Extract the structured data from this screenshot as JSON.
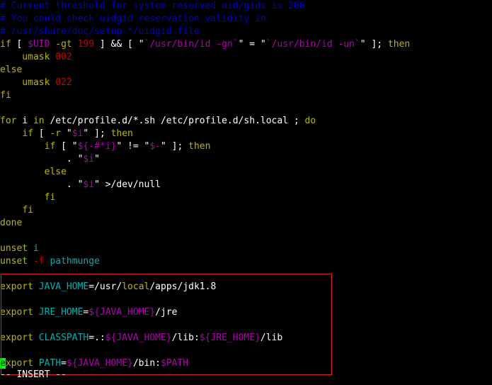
{
  "editor": {
    "mode_text": "-- INSERT --",
    "cursor_char": "e"
  },
  "colors": {
    "comment": "#0000cc",
    "keyword": "#b8b800",
    "variable": "#b000b0",
    "number": "#cc0000",
    "identifier": "#00b0b0",
    "default": "#ffffff",
    "highlight_border": "#e02020",
    "cursor": "#00ff00"
  },
  "lines": [
    [
      {
        "t": "# Current threshold for system reserved uid/gids is 200",
        "c": "comment"
      }
    ],
    [
      {
        "t": "# You could check uidgid reservation validity in",
        "c": "comment"
      }
    ],
    [
      {
        "t": "# /usr/share/doc/setup-*/uidgid file",
        "c": "comment"
      }
    ],
    [
      {
        "t": "if",
        "c": "keyword"
      },
      {
        "t": " [ ",
        "c": "default"
      },
      {
        "t": "$UID",
        "c": "variable"
      },
      {
        "t": " ",
        "c": "default"
      },
      {
        "t": "-gt",
        "c": "keyword"
      },
      {
        "t": " ",
        "c": "default"
      },
      {
        "t": "199",
        "c": "number"
      },
      {
        "t": " ] && [ \"",
        "c": "default"
      },
      {
        "t": "`/usr/bin/id -gn`",
        "c": "variable"
      },
      {
        "t": "\" = \"",
        "c": "default"
      },
      {
        "t": "`/usr/bin/id -un`",
        "c": "variable"
      },
      {
        "t": "\" ]; ",
        "c": "default"
      },
      {
        "t": "then",
        "c": "keyword"
      }
    ],
    [
      {
        "t": "    umask ",
        "c": "keyword"
      },
      {
        "t": "002",
        "c": "number"
      }
    ],
    [
      {
        "t": "else",
        "c": "keyword"
      }
    ],
    [
      {
        "t": "    umask ",
        "c": "keyword"
      },
      {
        "t": "022",
        "c": "number"
      }
    ],
    [
      {
        "t": "fi",
        "c": "keyword"
      }
    ],
    [],
    [
      {
        "t": "for",
        "c": "keyword"
      },
      {
        "t": " i ",
        "c": "default"
      },
      {
        "t": "in",
        "c": "keyword"
      },
      {
        "t": " /etc/profile.d/*.sh /etc/profile.d/sh.local ; ",
        "c": "default"
      },
      {
        "t": "do",
        "c": "keyword"
      }
    ],
    [
      {
        "t": "    ",
        "c": "default"
      },
      {
        "t": "if",
        "c": "keyword"
      },
      {
        "t": " [ ",
        "c": "default"
      },
      {
        "t": "-r",
        "c": "keyword"
      },
      {
        "t": " \"",
        "c": "default"
      },
      {
        "t": "$i",
        "c": "variable"
      },
      {
        "t": "\" ]; ",
        "c": "default"
      },
      {
        "t": "then",
        "c": "keyword"
      }
    ],
    [
      {
        "t": "        ",
        "c": "default"
      },
      {
        "t": "if",
        "c": "keyword"
      },
      {
        "t": " [ \"",
        "c": "default"
      },
      {
        "t": "${-#*i}",
        "c": "variable"
      },
      {
        "t": "\" != \"",
        "c": "default"
      },
      {
        "t": "$-",
        "c": "variable"
      },
      {
        "t": "\" ]; ",
        "c": "default"
      },
      {
        "t": "then",
        "c": "keyword"
      }
    ],
    [
      {
        "t": "            . \"",
        "c": "default"
      },
      {
        "t": "$i",
        "c": "variable"
      },
      {
        "t": "\"",
        "c": "default"
      }
    ],
    [
      {
        "t": "        ",
        "c": "default"
      },
      {
        "t": "else",
        "c": "keyword"
      }
    ],
    [
      {
        "t": "            . \"",
        "c": "default"
      },
      {
        "t": "$i",
        "c": "variable"
      },
      {
        "t": "\" >/dev/null",
        "c": "default"
      }
    ],
    [
      {
        "t": "        ",
        "c": "default"
      },
      {
        "t": "fi",
        "c": "keyword"
      }
    ],
    [
      {
        "t": "    ",
        "c": "default"
      },
      {
        "t": "fi",
        "c": "keyword"
      }
    ],
    [
      {
        "t": "done",
        "c": "keyword"
      }
    ],
    [],
    [
      {
        "t": "unset",
        "c": "keyword"
      },
      {
        "t": " ",
        "c": "default"
      },
      {
        "t": "i",
        "c": "identifier"
      }
    ],
    [
      {
        "t": "unset",
        "c": "keyword"
      },
      {
        "t": " ",
        "c": "default"
      },
      {
        "t": "-f",
        "c": "number"
      },
      {
        "t": " ",
        "c": "default"
      },
      {
        "t": "pathmunge",
        "c": "identifier"
      }
    ],
    [],
    [
      {
        "t": "export",
        "c": "keyword"
      },
      {
        "t": " ",
        "c": "default"
      },
      {
        "t": "JAVA_HOME",
        "c": "identifier"
      },
      {
        "t": "=/usr/",
        "c": "default"
      },
      {
        "t": "local",
        "c": "keyword"
      },
      {
        "t": "/apps/jdk1.8",
        "c": "default"
      }
    ],
    [],
    [
      {
        "t": "export",
        "c": "keyword"
      },
      {
        "t": " ",
        "c": "default"
      },
      {
        "t": "JRE_HOME",
        "c": "identifier"
      },
      {
        "t": "=",
        "c": "default"
      },
      {
        "t": "${JAVA_HOME}",
        "c": "variable"
      },
      {
        "t": "/jre",
        "c": "default"
      }
    ],
    [],
    [
      {
        "t": "export",
        "c": "keyword"
      },
      {
        "t": " ",
        "c": "default"
      },
      {
        "t": "CLASSPATH",
        "c": "identifier"
      },
      {
        "t": "=.:",
        "c": "default"
      },
      {
        "t": "${JAVA_HOME}",
        "c": "variable"
      },
      {
        "t": "/lib:",
        "c": "default"
      },
      {
        "t": "${JRE_HOME}",
        "c": "variable"
      },
      {
        "t": "/lib",
        "c": "default"
      }
    ],
    [],
    [
      {
        "t": "xport",
        "c": "keyword"
      },
      {
        "t": " ",
        "c": "default"
      },
      {
        "t": "PATH",
        "c": "identifier"
      },
      {
        "t": "=",
        "c": "default"
      },
      {
        "t": "${JAVA_HOME}",
        "c": "variable"
      },
      {
        "t": "/bin:",
        "c": "default"
      },
      {
        "t": "$PATH",
        "c": "variable"
      }
    ]
  ]
}
